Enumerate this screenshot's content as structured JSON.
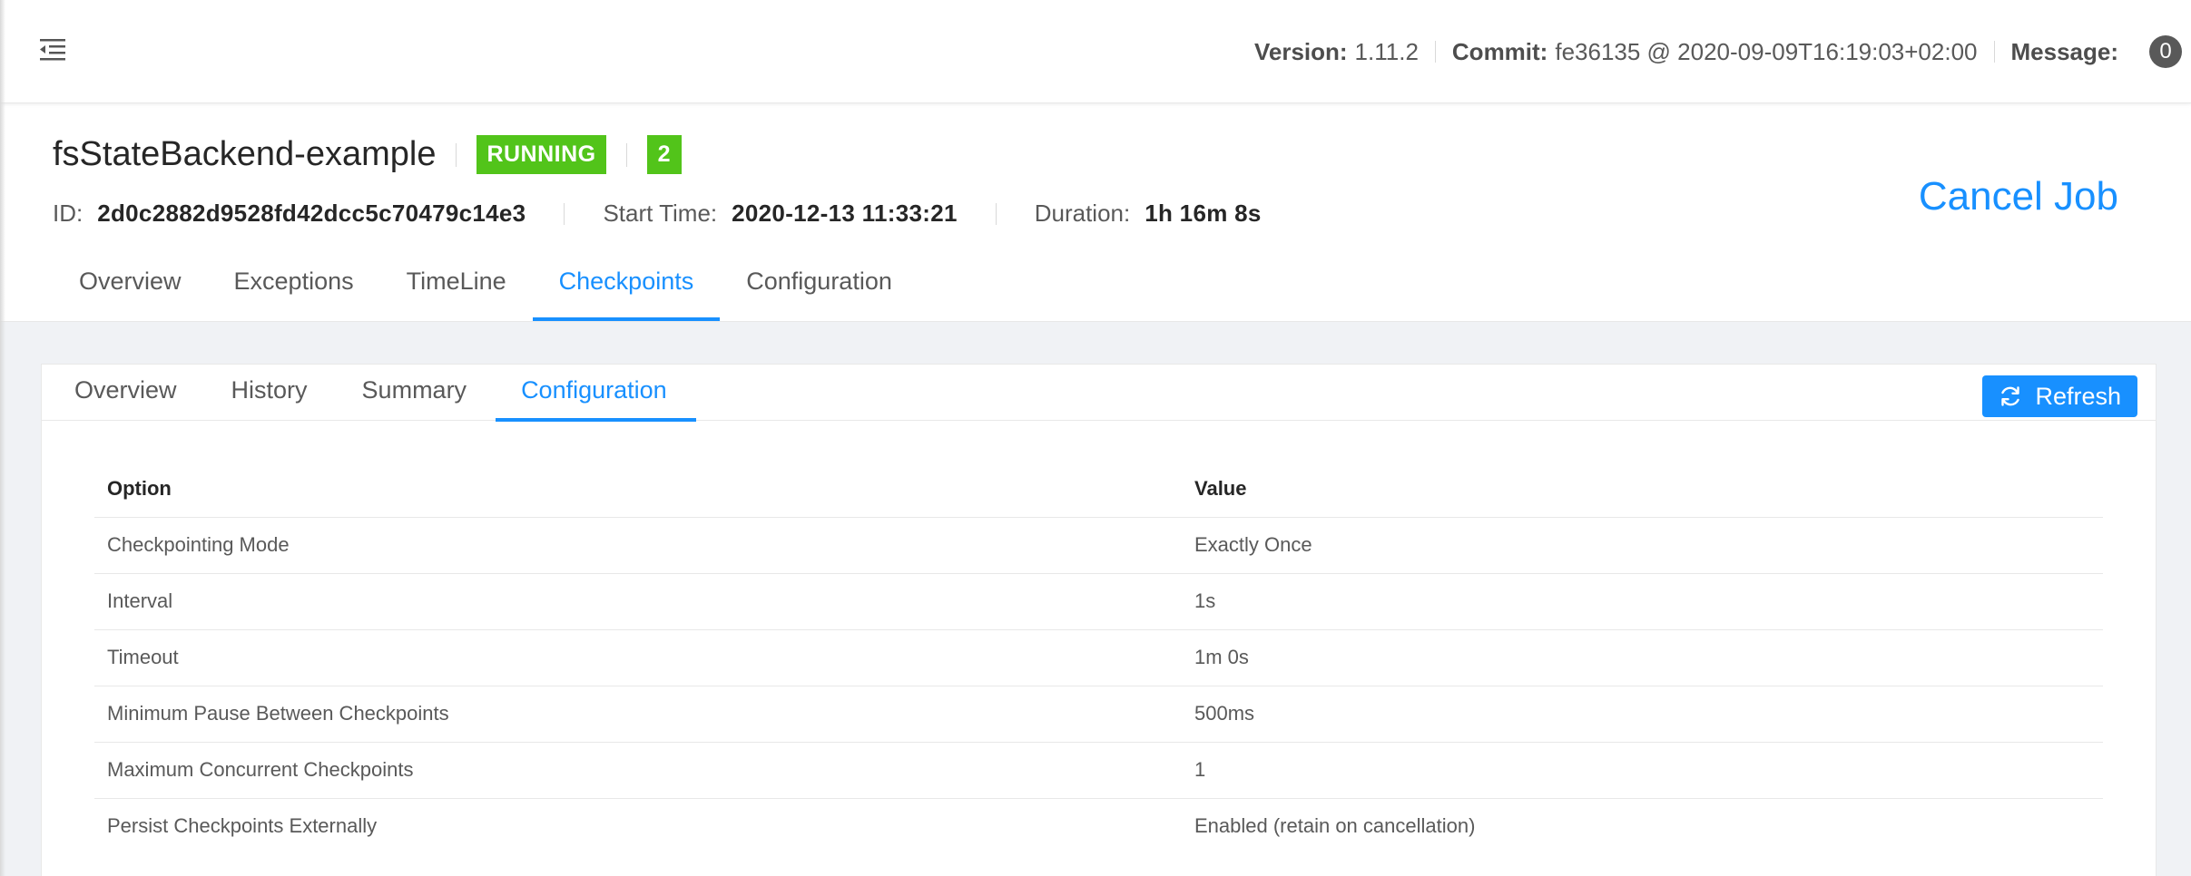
{
  "topbar": {
    "version_label": "Version:",
    "version_value": "1.11.2",
    "commit_label": "Commit:",
    "commit_value": "fe36135 @ 2020-09-09T16:19:03+02:00",
    "message_label": "Message:",
    "message_count": "0"
  },
  "job": {
    "name": "fsStateBackend-example",
    "status": "RUNNING",
    "count": "2",
    "id_label": "ID:",
    "id_value": "2d0c2882d9528fd42dcc5c70479c14e3",
    "start_label": "Start Time:",
    "start_value": "2020-12-13 11:33:21",
    "duration_label": "Duration:",
    "duration_value": "1h 16m 8s",
    "cancel_label": "Cancel Job",
    "tabs": [
      {
        "label": "Overview"
      },
      {
        "label": "Exceptions"
      },
      {
        "label": "TimeLine"
      },
      {
        "label": "Checkpoints"
      },
      {
        "label": "Configuration"
      }
    ],
    "active_tab": "Checkpoints"
  },
  "checkpoints": {
    "tabs": [
      {
        "label": "Overview"
      },
      {
        "label": "History"
      },
      {
        "label": "Summary"
      },
      {
        "label": "Configuration"
      }
    ],
    "active_tab": "Configuration",
    "refresh_label": "Refresh",
    "table": {
      "headers": {
        "option": "Option",
        "value": "Value"
      },
      "rows": [
        {
          "option": "Checkpointing Mode",
          "value": "Exactly Once"
        },
        {
          "option": "Interval",
          "value": "1s"
        },
        {
          "option": "Timeout",
          "value": "1m 0s"
        },
        {
          "option": "Minimum Pause Between Checkpoints",
          "value": "500ms"
        },
        {
          "option": "Maximum Concurrent Checkpoints",
          "value": "1"
        },
        {
          "option": "Persist Checkpoints Externally",
          "value": "Enabled (retain on cancellation)"
        }
      ]
    }
  },
  "colors": {
    "accent": "#1890ff",
    "running": "#52c41a"
  },
  "icons": {
    "menu": "menu-fold-icon",
    "refresh": "sync-icon"
  }
}
